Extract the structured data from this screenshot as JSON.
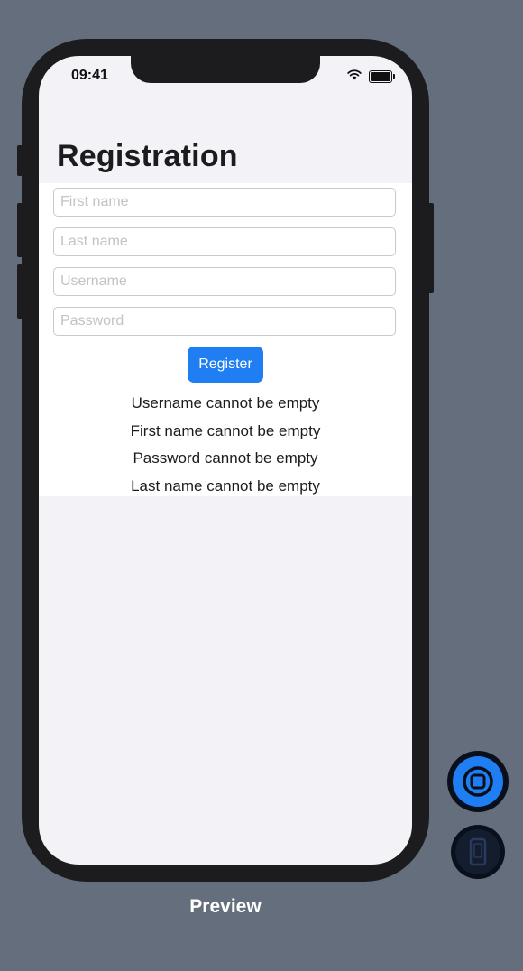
{
  "status_bar": {
    "time": "09:41",
    "icons": [
      "wifi-icon",
      "battery-icon"
    ]
  },
  "navigation": {
    "title": "Registration"
  },
  "form": {
    "fields": [
      {
        "name": "first-name-field",
        "placeholder": "First name",
        "value": ""
      },
      {
        "name": "last-name-field",
        "placeholder": "Last name",
        "value": ""
      },
      {
        "name": "username-field",
        "placeholder": "Username",
        "value": ""
      },
      {
        "name": "password-field",
        "placeholder": "Password",
        "value": ""
      }
    ],
    "register_label": "Register",
    "errors": [
      "Username cannot be empty",
      "First name cannot be empty",
      "Password cannot be empty",
      "Last name cannot be empty"
    ]
  },
  "preview": {
    "label": "Preview",
    "controls": [
      "live-preview-icon",
      "device-preview-icon"
    ]
  },
  "colors": {
    "canvas_background": "#646e7c",
    "accent": "#1e7ef2",
    "screen_background": "#f2f2f7",
    "form_background": "#ffffff"
  }
}
